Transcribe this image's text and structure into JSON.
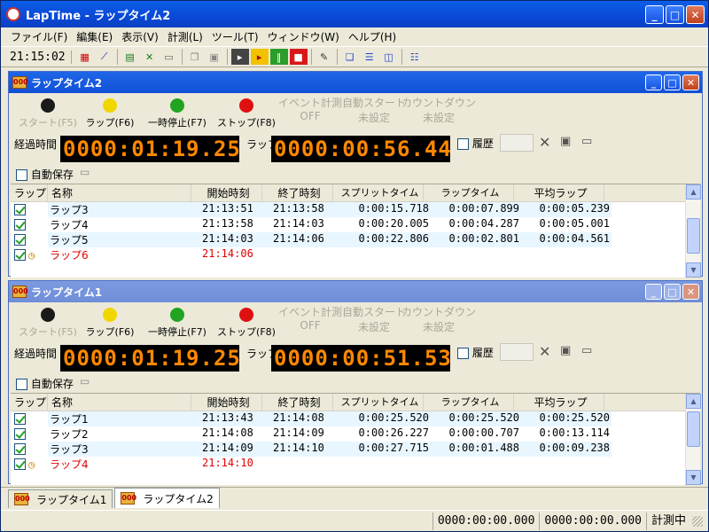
{
  "app": {
    "title": "LapTime - ラップタイム2"
  },
  "menu": [
    "ファイル(F)",
    "編集(E)",
    "表示(V)",
    "計測(L)",
    "ツール(T)",
    "ウィンドウ(W)",
    "ヘルプ(H)"
  ],
  "toolbar": {
    "clock": "21:15:02"
  },
  "windows": [
    {
      "title": "ラップタイム2",
      "buttons": {
        "start": "スタート(F5)",
        "lap": "ラップ(F6)",
        "pause": "一時停止(F7)",
        "stop": "ストップ(F8)",
        "event": "イベント計測",
        "event_val": "OFF",
        "autostart": "自動スタート",
        "autostart_val": "未設定",
        "countdown": "カウントダウン",
        "countdown_val": "未設定"
      },
      "colors": {
        "start": "#1a1a1a",
        "lap": "#f2d600",
        "pause": "#22a322",
        "stop": "#e01010"
      },
      "elapsed_label": "経過時間",
      "elapsed": "0000:01:19.25",
      "lap_label": "ラップ",
      "lap_time": "0000:00:56.44",
      "history_label": "履歴",
      "autosave_label": "自動保存",
      "headers": [
        "ラップ",
        "名称",
        "開始時刻",
        "終了時刻",
        "スプリットタイム",
        "ラップタイム",
        "平均ラップ"
      ],
      "rows": [
        {
          "name": "ラップ3",
          "start": "21:13:51",
          "end": "21:13:58",
          "split": "0:00:15.718",
          "lap": "0:00:07.899",
          "avg": "0:00:05.239"
        },
        {
          "name": "ラップ4",
          "start": "21:13:58",
          "end": "21:14:03",
          "split": "0:00:20.005",
          "lap": "0:00:04.287",
          "avg": "0:00:05.001"
        },
        {
          "name": "ラップ5",
          "start": "21:14:03",
          "end": "21:14:06",
          "split": "0:00:22.806",
          "lap": "0:00:02.801",
          "avg": "0:00:04.561"
        },
        {
          "name": "ラップ6",
          "start": "21:14:06",
          "end": "",
          "split": "",
          "lap": "",
          "avg": "",
          "current": true
        }
      ]
    },
    {
      "title": "ラップタイム1",
      "buttons": {
        "start": "スタート(F5)",
        "lap": "ラップ(F6)",
        "pause": "一時停止(F7)",
        "stop": "ストップ(F8)",
        "event": "イベント計測",
        "event_val": "OFF",
        "autostart": "自動スタート",
        "autostart_val": "未設定",
        "countdown": "カウントダウン",
        "countdown_val": "未設定"
      },
      "colors": {
        "start": "#1a1a1a",
        "lap": "#f2d600",
        "pause": "#22a322",
        "stop": "#e01010"
      },
      "elapsed_label": "経過時間",
      "elapsed": "0000:01:19.25",
      "lap_label": "ラップ",
      "lap_time": "0000:00:51.53",
      "history_label": "履歴",
      "autosave_label": "自動保存",
      "headers": [
        "ラップ",
        "名称",
        "開始時刻",
        "終了時刻",
        "スプリットタイム",
        "ラップタイム",
        "平均ラップ"
      ],
      "rows": [
        {
          "name": "ラップ1",
          "start": "21:13:43",
          "end": "21:14:08",
          "split": "0:00:25.520",
          "lap": "0:00:25.520",
          "avg": "0:00:25.520"
        },
        {
          "name": "ラップ2",
          "start": "21:14:08",
          "end": "21:14:09",
          "split": "0:00:26.227",
          "lap": "0:00:00.707",
          "avg": "0:00:13.114"
        },
        {
          "name": "ラップ3",
          "start": "21:14:09",
          "end": "21:14:10",
          "split": "0:00:27.715",
          "lap": "0:00:01.488",
          "avg": "0:00:09.238"
        },
        {
          "name": "ラップ4",
          "start": "21:14:10",
          "end": "",
          "split": "",
          "lap": "",
          "avg": "",
          "current": true
        }
      ]
    }
  ],
  "tabs": [
    "ラップタイム1",
    "ラップタイム2"
  ],
  "status": {
    "time1": "0000:00:00.000",
    "time2": "0000:00:00.000",
    "state": "計測中"
  }
}
